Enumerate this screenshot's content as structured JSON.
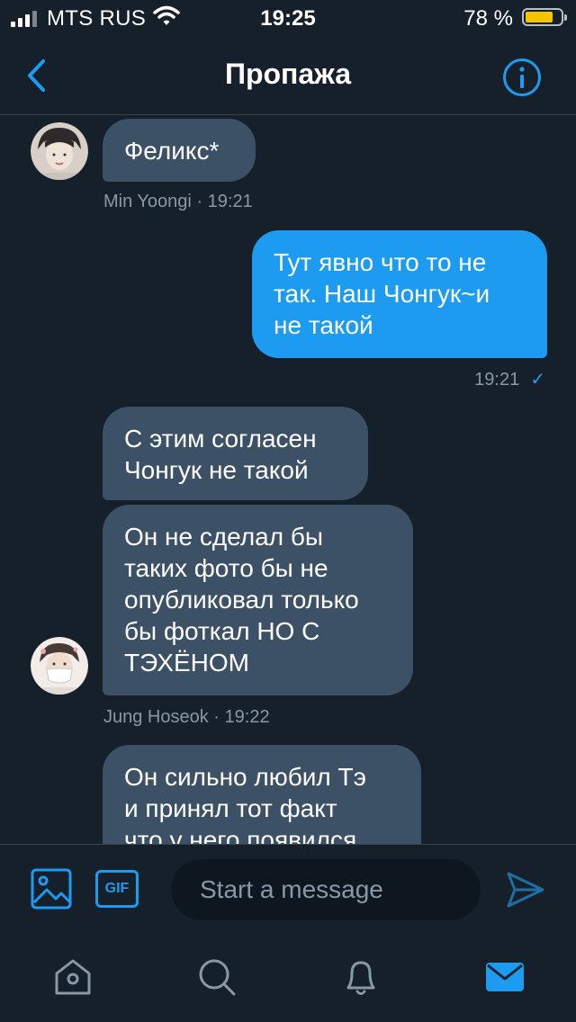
{
  "status_bar": {
    "carrier": "MTS RUS",
    "time": "19:25",
    "battery": "78 %",
    "battery_level": 0.78
  },
  "header": {
    "title": "Пропажа"
  },
  "messages": [
    {
      "direction": "in",
      "lines": [
        "Феликс*"
      ]
    },
    {
      "meta": "Min Yoongi · 19:21"
    },
    {
      "direction": "out",
      "lines": [
        "Тут явно что то не",
        "так. Наш Чонгук~и",
        "не такой"
      ]
    },
    {
      "meta": "19:21",
      "read_check": "✓"
    },
    {
      "direction": "in",
      "lines": [
        "С этим согласен",
        "Чонгук не такой"
      ]
    },
    {
      "direction": "in",
      "lines": [
        "Он не сделал бы",
        "таких фото бы не",
        "опубликовал только",
        "бы фоткал НО С",
        "ТЭХЁНОМ"
      ]
    },
    {
      "meta": "Jung Hoseok · 19:22"
    },
    {
      "direction": "in",
      "lines": [
        "Он сильно любил Тэ",
        "и принял тот факт",
        "что у него появился"
      ]
    }
  ],
  "composer": {
    "gif_label": "GIF",
    "placeholder": "Start a message"
  },
  "tabbar": {
    "items": [
      "home-icon",
      "search-icon",
      "notifications-icon",
      "messages-icon"
    ],
    "active": "messages-icon"
  },
  "colors": {
    "background": "#15202b",
    "accent": "#1d9bf0",
    "incoming_bubble": "#3d5166",
    "muted_text": "#8899a6",
    "battery": "#f5c400"
  }
}
